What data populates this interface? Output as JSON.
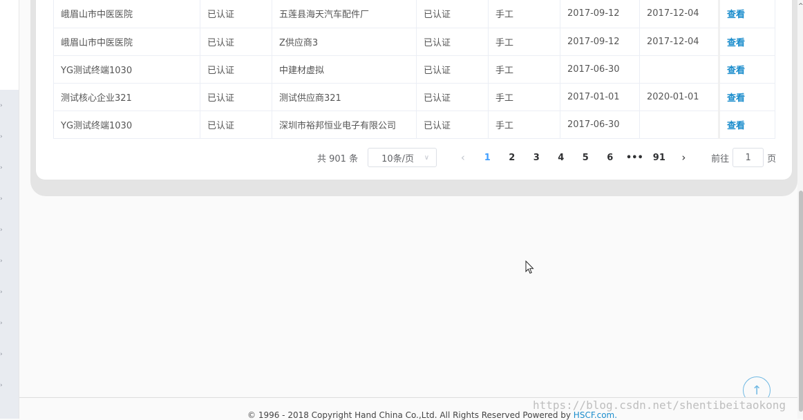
{
  "table": {
    "rows": [
      {
        "core": "峨眉山市中医医院",
        "core_status": "已认证",
        "supplier": "五莲县海天汽车配件厂",
        "supplier_status": "已认证",
        "method": "手工",
        "start": "2017-09-12",
        "end": "2017-12-04",
        "action": "查看"
      },
      {
        "core": "峨眉山市中医医院",
        "core_status": "已认证",
        "supplier": "Z供应商3",
        "supplier_status": "已认证",
        "method": "手工",
        "start": "2017-09-12",
        "end": "2017-12-04",
        "action": "查看"
      },
      {
        "core": "YG测试终端1030",
        "core_status": "已认证",
        "supplier": "中建材虚拟",
        "supplier_status": "已认证",
        "method": "手工",
        "start": "2017-06-30",
        "end": "",
        "action": "查看"
      },
      {
        "core": "测试核心企业321",
        "core_status": "已认证",
        "supplier": "测试供应商321",
        "supplier_status": "已认证",
        "method": "手工",
        "start": "2017-01-01",
        "end": "2020-01-01",
        "action": "查看"
      },
      {
        "core": "YG测试终端1030",
        "core_status": "已认证",
        "supplier": "深圳市裕邦恒业电子有限公司",
        "supplier_status": "已认证",
        "method": "手工",
        "start": "2017-06-30",
        "end": "",
        "action": "查看"
      }
    ]
  },
  "pagination": {
    "total": "共 901 条",
    "page_size": "10条/页",
    "prev_icon": "chevron-left-icon",
    "next_icon": "chevron-right-icon",
    "pages": [
      "1",
      "2",
      "3",
      "4",
      "5",
      "6",
      "•••",
      "91"
    ],
    "current": "1",
    "goto_label": "前往",
    "goto_value": "1",
    "goto_suffix": "页"
  },
  "back_to_top_icon": "arrow-up-icon",
  "footer": {
    "text": "© 1996 - 2018 Copyright Hand China Co.,Ltd. All Rights Reserved Powered by ",
    "link": "HSCF.com."
  },
  "watermark": "https://blog.csdn.net/shentibeitaokong",
  "colors": {
    "accent": "#409eff",
    "link": "#1a8ccc"
  }
}
